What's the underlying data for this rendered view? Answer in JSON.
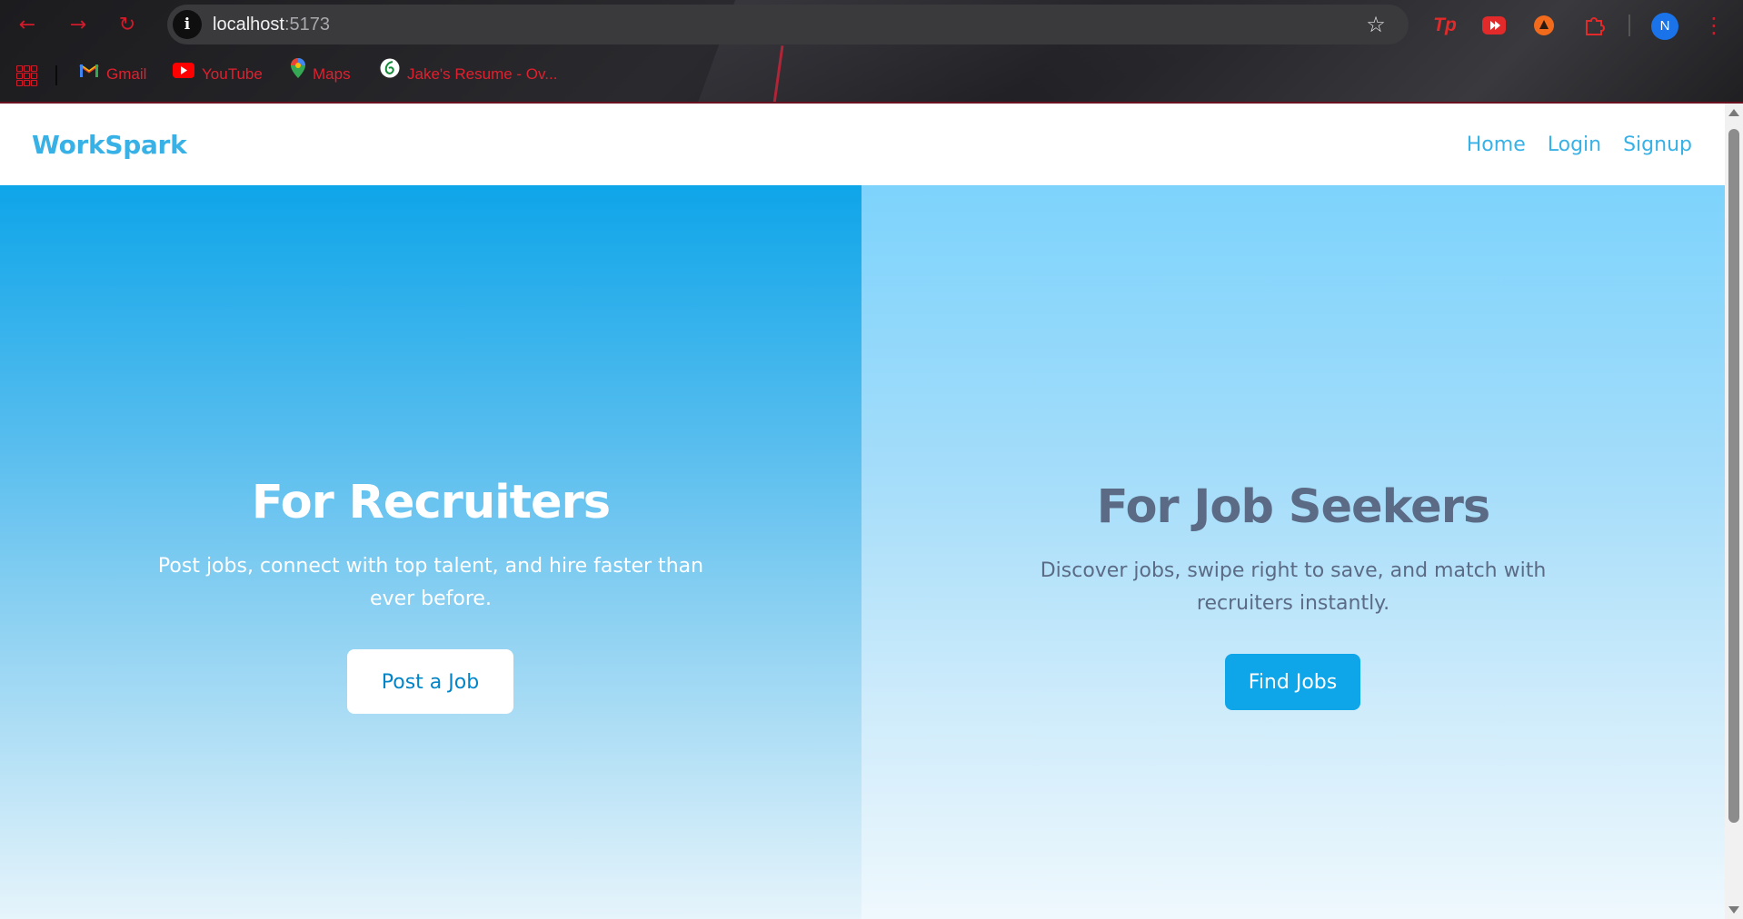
{
  "browser": {
    "address": {
      "host": "localhost",
      "port": ":5173"
    },
    "bookmarks": [
      {
        "label": "Gmail",
        "icon": "gmail-icon"
      },
      {
        "label": "YouTube",
        "icon": "youtube-icon"
      },
      {
        "label": "Maps",
        "icon": "maps-icon"
      },
      {
        "label": "Jake's Resume - Ov...",
        "icon": "overleaf-icon"
      }
    ],
    "profile_initial": "N",
    "extensions": [
      "tp-extension-icon",
      "youtube-extension-icon",
      "orange-extension-icon",
      "puzzle-extensions-icon"
    ]
  },
  "app": {
    "brand": "WorkSpark",
    "nav": {
      "home": "Home",
      "login": "Login",
      "signup": "Signup"
    },
    "recruiters": {
      "title": "For Recruiters",
      "description": "Post jobs, connect with top talent, and hire faster than ever before.",
      "button": "Post a Job"
    },
    "seekers": {
      "title": "For Job Seekers",
      "description": "Discover jobs, swipe right to save, and match with recruiters instantly.",
      "button": "Find Jobs"
    }
  },
  "colors": {
    "brand": "#38b2e6",
    "primary_button": "#0ea5e9",
    "heading_dark": "#5b6b85"
  }
}
